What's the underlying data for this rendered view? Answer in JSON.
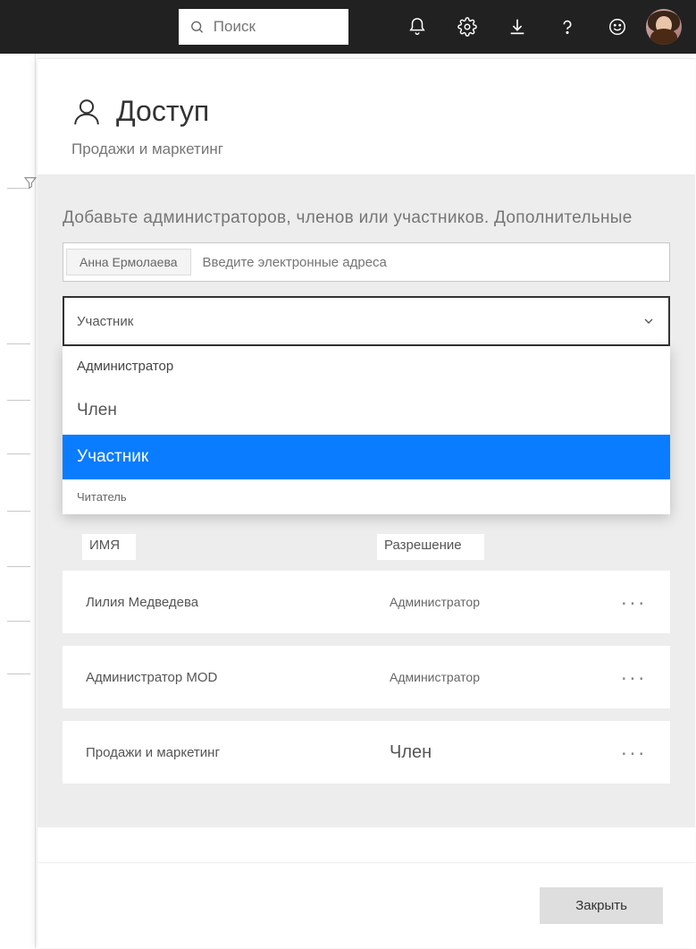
{
  "topbar": {
    "search_placeholder": "Поиск"
  },
  "panel": {
    "title": "Доступ",
    "subtitle": "Продажи и маркетинг",
    "instruction": "Добавьте администраторов, членов или участников. Дополнительные",
    "chip": "Анна Ермолаева",
    "email_placeholder": "Введите электронные адреса",
    "select_value": "Участник",
    "dropdown": {
      "opt_admin": "Администратор",
      "opt_member": "Член",
      "opt_participant": "Участник",
      "opt_reader": "Читатель"
    },
    "table": {
      "col_name": "ИМЯ",
      "col_perm": "Разрешение"
    },
    "rows": [
      {
        "name": "Лилия Медведева",
        "perm": "Администратор"
      },
      {
        "name": "Администратор MOD",
        "perm": "Администратор"
      },
      {
        "name": "Продажи и маркетинг",
        "perm": "Член"
      }
    ],
    "close": "Закрыть"
  }
}
